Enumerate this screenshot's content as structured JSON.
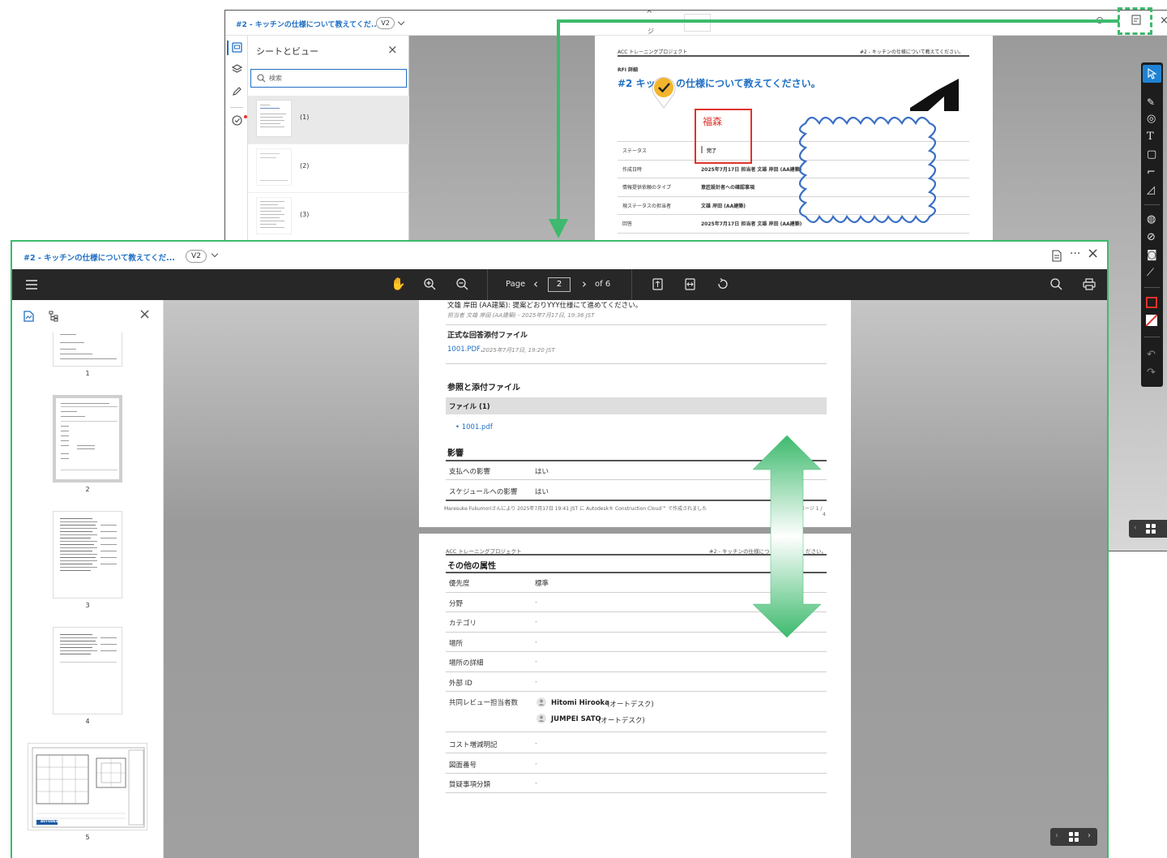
{
  "background_viewer": {
    "title": "#2 - キッチンの仕様について教えてくだ...",
    "version": "V2",
    "panel": {
      "title": "シートとビュー",
      "search_placeholder": "検索",
      "sheets": [
        {
          "label": "(1)"
        },
        {
          "label": "(2)"
        },
        {
          "label": "(3)"
        }
      ]
    },
    "doc": {
      "project_header": "ACC トレーニングプロジェクト",
      "doc_header_right": "#2 - キッチンの仕様について教えてください。",
      "section_label": "RFI 詳細",
      "heading_left": "#2 キッ",
      "heading_right": "の仕様について教えてください。",
      "stamp_name": "福森",
      "rows": [
        {
          "label": "ステータス",
          "value": "完了"
        },
        {
          "label": "作成日時",
          "value": "2025年7月17日 担当者 文雄 岸田 (AA建築)"
        },
        {
          "label": "情報提供依頼のタイプ",
          "value": "意匠設計者への確認事項"
        },
        {
          "label": "現ステータスの担当者",
          "value": "文雄 岸田 (AA建築)"
        },
        {
          "label": "回答",
          "value": "2025年7月17日 担当者 文雄 岸田 (AA建築)"
        }
      ]
    }
  },
  "foreground_viewer": {
    "title": "#2 - キッチンの仕様について教えてくだ...",
    "version": "V2",
    "toolbar": {
      "page_label": "Page",
      "current_page": "2",
      "of_label": "of 6"
    },
    "thumbnails": [
      {
        "num": "1"
      },
      {
        "num": "2"
      },
      {
        "num": "3"
      },
      {
        "num": "4"
      },
      {
        "num": "5"
      }
    ],
    "page_top": {
      "answer_line": "文雄 岸田 (AA建築): 提案どおりYYY仕様にて進めてください。",
      "answer_meta": "担当者 文雄 岸田 (AA建築) - 2025年7月17日, 19:36 JST",
      "formal_attach_title": "正式な回答添付ファイル",
      "formal_attach_link": "1001.PDF,",
      "formal_attach_date": "2025年7月17日, 19:20 JST",
      "ref_title": "参照と添付ファイル",
      "files_header": "ファイル (1)",
      "file_link": "• 1001.pdf",
      "impact_title": "影響",
      "impact_rows": [
        {
          "label": "支払への影響",
          "value": "はい"
        },
        {
          "label": "スケジュールへの影響",
          "value": "はい"
        }
      ],
      "footer": "Maresuke Fukumoriさんにより 2025年7月17日 19:41 JST に Autodesk® Construction Cloud™ で作成されました",
      "footer_page_a": "ページ 1 /",
      "footer_page_b": "4"
    },
    "page_bottom": {
      "project_header": "ACC トレーニングプロジェクト",
      "doc_header_right": "#2 - キッチンの仕様につ",
      "doc_header_right_tail": "ださい。",
      "section_title": "その他の属性",
      "rows": [
        {
          "label": "優先度",
          "value": "標準"
        },
        {
          "label": "分野",
          "value": "-"
        },
        {
          "label": "カテゴリ",
          "value": "-"
        },
        {
          "label": "場所",
          "value": "-"
        },
        {
          "label": "場所の詳細",
          "value": "-"
        },
        {
          "label": "外部 ID",
          "value": "-"
        }
      ],
      "reviewers_label": "共同レビュー担当者数",
      "reviewers": [
        {
          "name": "Hitomi Hirooka",
          "org": "(オートデスク)"
        },
        {
          "name": "JUMPEI SATO",
          "org": "(オートデスク)"
        }
      ],
      "rows2": [
        {
          "label": "コスト増減明記",
          "value": "-"
        },
        {
          "label": "図面番号",
          "value": "-"
        },
        {
          "label": "質疑事項分類",
          "value": "-"
        }
      ]
    },
    "thumb5_logo": "AUTODESK"
  },
  "colors": {
    "accent_green": "#3dba6d",
    "link_blue": "#1f6fc4",
    "stamp_red": "#e0332b",
    "cloud_blue": "#3a6fc4",
    "check_yellow": "#f3b52d",
    "toolbar_dark": "#272727"
  }
}
